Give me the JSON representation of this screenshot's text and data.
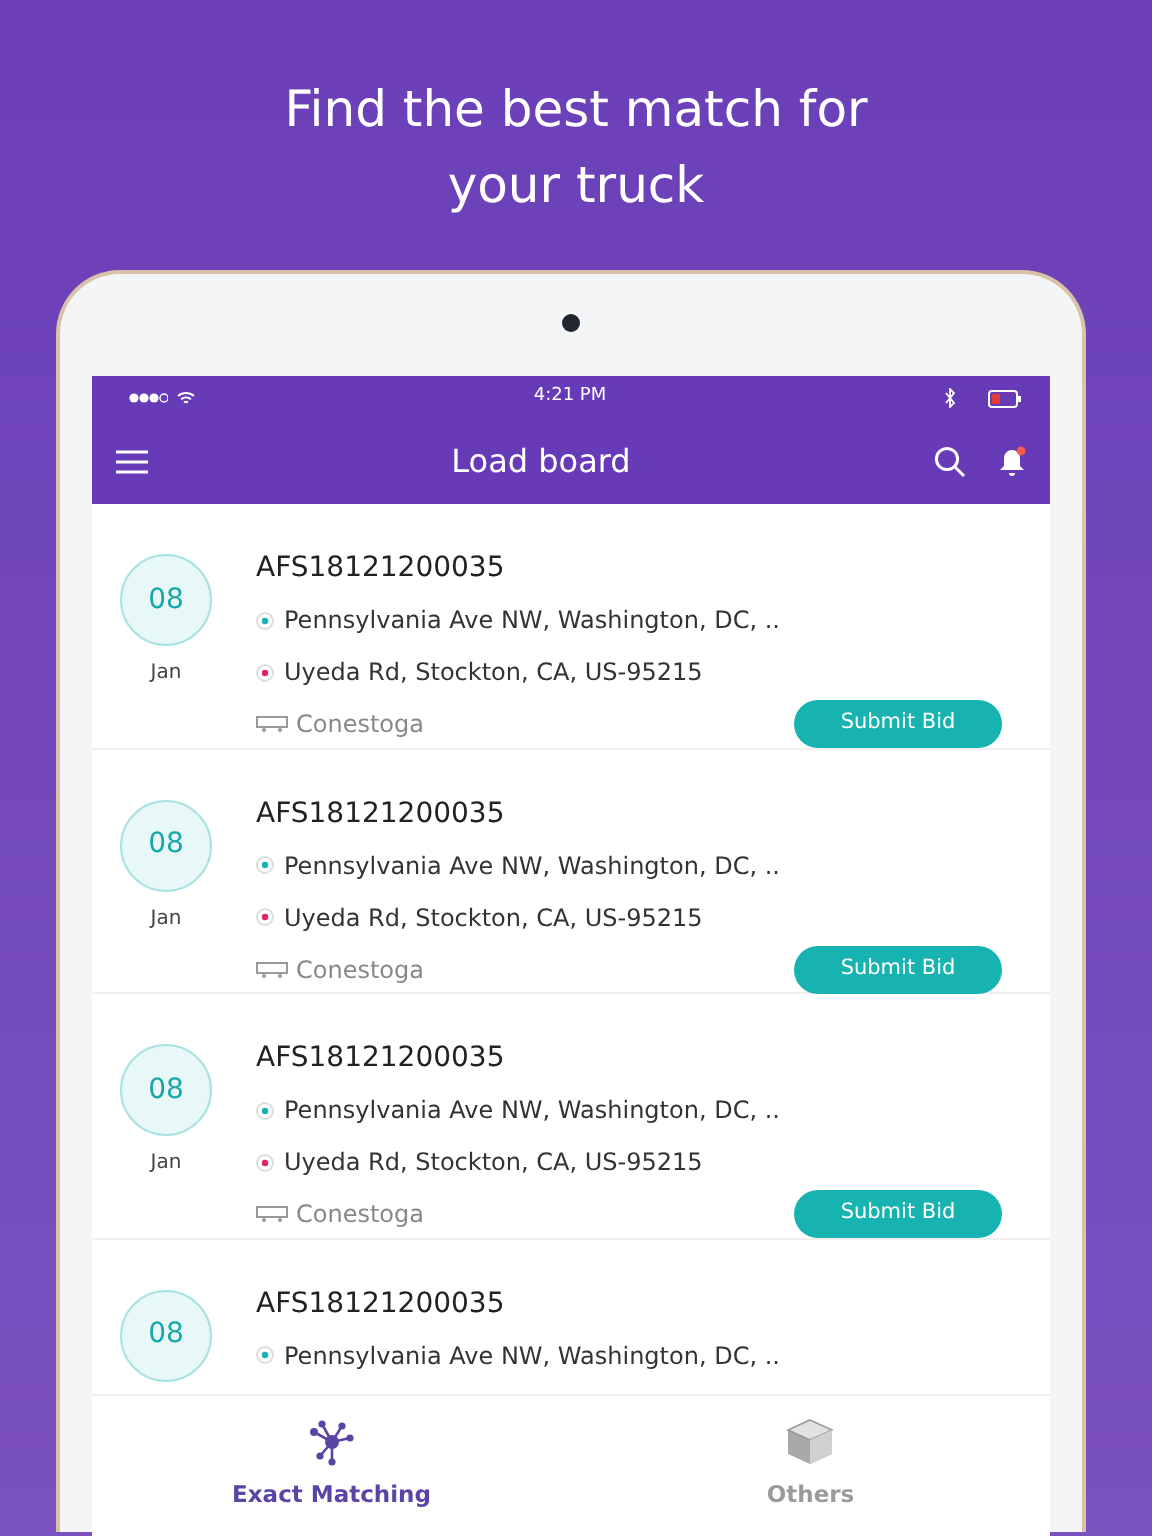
{
  "headline": "Find the best match for your truck",
  "status_bar": {
    "time": "4:21 PM"
  },
  "app_bar": {
    "title": "Load board",
    "notification_badge": true
  },
  "loads": [
    {
      "day": "08",
      "month": "Jan",
      "id": "AFS18121200035",
      "origin": "Pennsylvania Ave NW, Washington, DC, ..",
      "destination": "Uyeda Rd, Stockton, CA, US-95215",
      "trailer": "Conestoga",
      "button": "Submit Bid"
    },
    {
      "day": "08",
      "month": "Jan",
      "id": "AFS18121200035",
      "origin": "Pennsylvania Ave NW, Washington, DC, ..",
      "destination": "Uyeda Rd, Stockton, CA, US-95215",
      "trailer": "Conestoga",
      "button": "Submit Bid"
    },
    {
      "day": "08",
      "month": "Jan",
      "id": "AFS18121200035",
      "origin": "Pennsylvania Ave NW, Washington, DC, ..",
      "destination": "Uyeda Rd, Stockton, CA, US-95215",
      "trailer": "Conestoga",
      "button": "Submit Bid"
    },
    {
      "day": "08",
      "id": "AFS18121200035",
      "origin": "Pennsylvania Ave NW, Washington, DC, .."
    }
  ],
  "tabs": [
    {
      "label": "Exact Matching",
      "selected": true,
      "kind": "network"
    },
    {
      "label": "Others",
      "selected": false,
      "kind": "box"
    }
  ]
}
